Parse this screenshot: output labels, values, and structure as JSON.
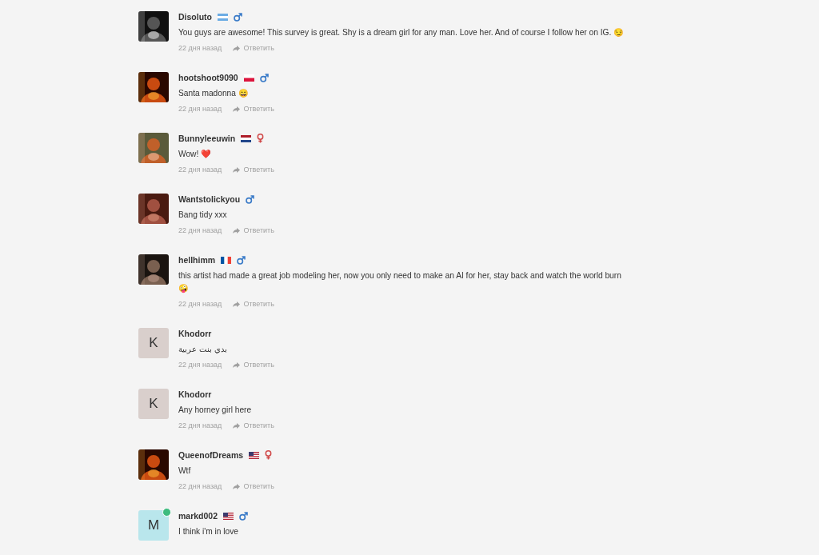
{
  "comments": [
    {
      "author": "Disoluto",
      "flag": {
        "kind": "ar"
      },
      "gender": {
        "kind": "male"
      },
      "text": "You guys are awesome! This survey is great. Shy is a dream girl for any man. Love her. And of course I follow her on IG. 😏",
      "time": "22 дня назад",
      "reply": "Ответить"
    },
    {
      "author": "hootshoot9090",
      "flag": {
        "kind": "pl"
      },
      "gender": {
        "kind": "male"
      },
      "text": "Santa madonna 😄",
      "time": "22 дня назад",
      "reply": "Ответить"
    },
    {
      "author": "Bunnyleeuwin",
      "flag": {
        "kind": "nl"
      },
      "gender": {
        "kind": "female"
      },
      "text": "Wow! ❤️",
      "time": "22 дня назад",
      "reply": "Ответить"
    },
    {
      "author": "Wantstolickyou",
      "gender": {
        "kind": "male"
      },
      "text": "Bang tidy xxx",
      "time": "22 дня назад",
      "reply": "Ответить"
    },
    {
      "author": "hellhimm",
      "flag": {
        "kind": "fr"
      },
      "gender": {
        "kind": "male"
      },
      "text": "this artist had made a great job modeling her, now you only need to make an AI for her, stay back and watch the world burn 🤪",
      "time": "22 дня назад",
      "reply": "Ответить"
    },
    {
      "author": "Khodorr",
      "avatar": {
        "kind": "letter",
        "letter": "K",
        "color": "#d9cfcc",
        "online": false
      },
      "text": "بدي بنت عربية",
      "time": "22 дня назад",
      "reply": "Ответить"
    },
    {
      "author": "Khodorr",
      "avatar": {
        "kind": "letter",
        "letter": "K",
        "color": "#d9cfcc",
        "online": false
      },
      "text": "Any horney girl here",
      "time": "22 дня назад",
      "reply": "Ответить"
    },
    {
      "author": "QueenofDreams",
      "flag": {
        "kind": "us"
      },
      "gender": {
        "kind": "female"
      },
      "text": "Wtf",
      "time": "22 дня назад",
      "reply": "Ответить"
    },
    {
      "author": "markd002",
      "flag": {
        "kind": "us"
      },
      "gender": {
        "kind": "male"
      },
      "avatar": {
        "kind": "letter",
        "letter": "M",
        "color": "#b9e6ec",
        "online": true
      },
      "text": "I think i'm in love"
    }
  ]
}
